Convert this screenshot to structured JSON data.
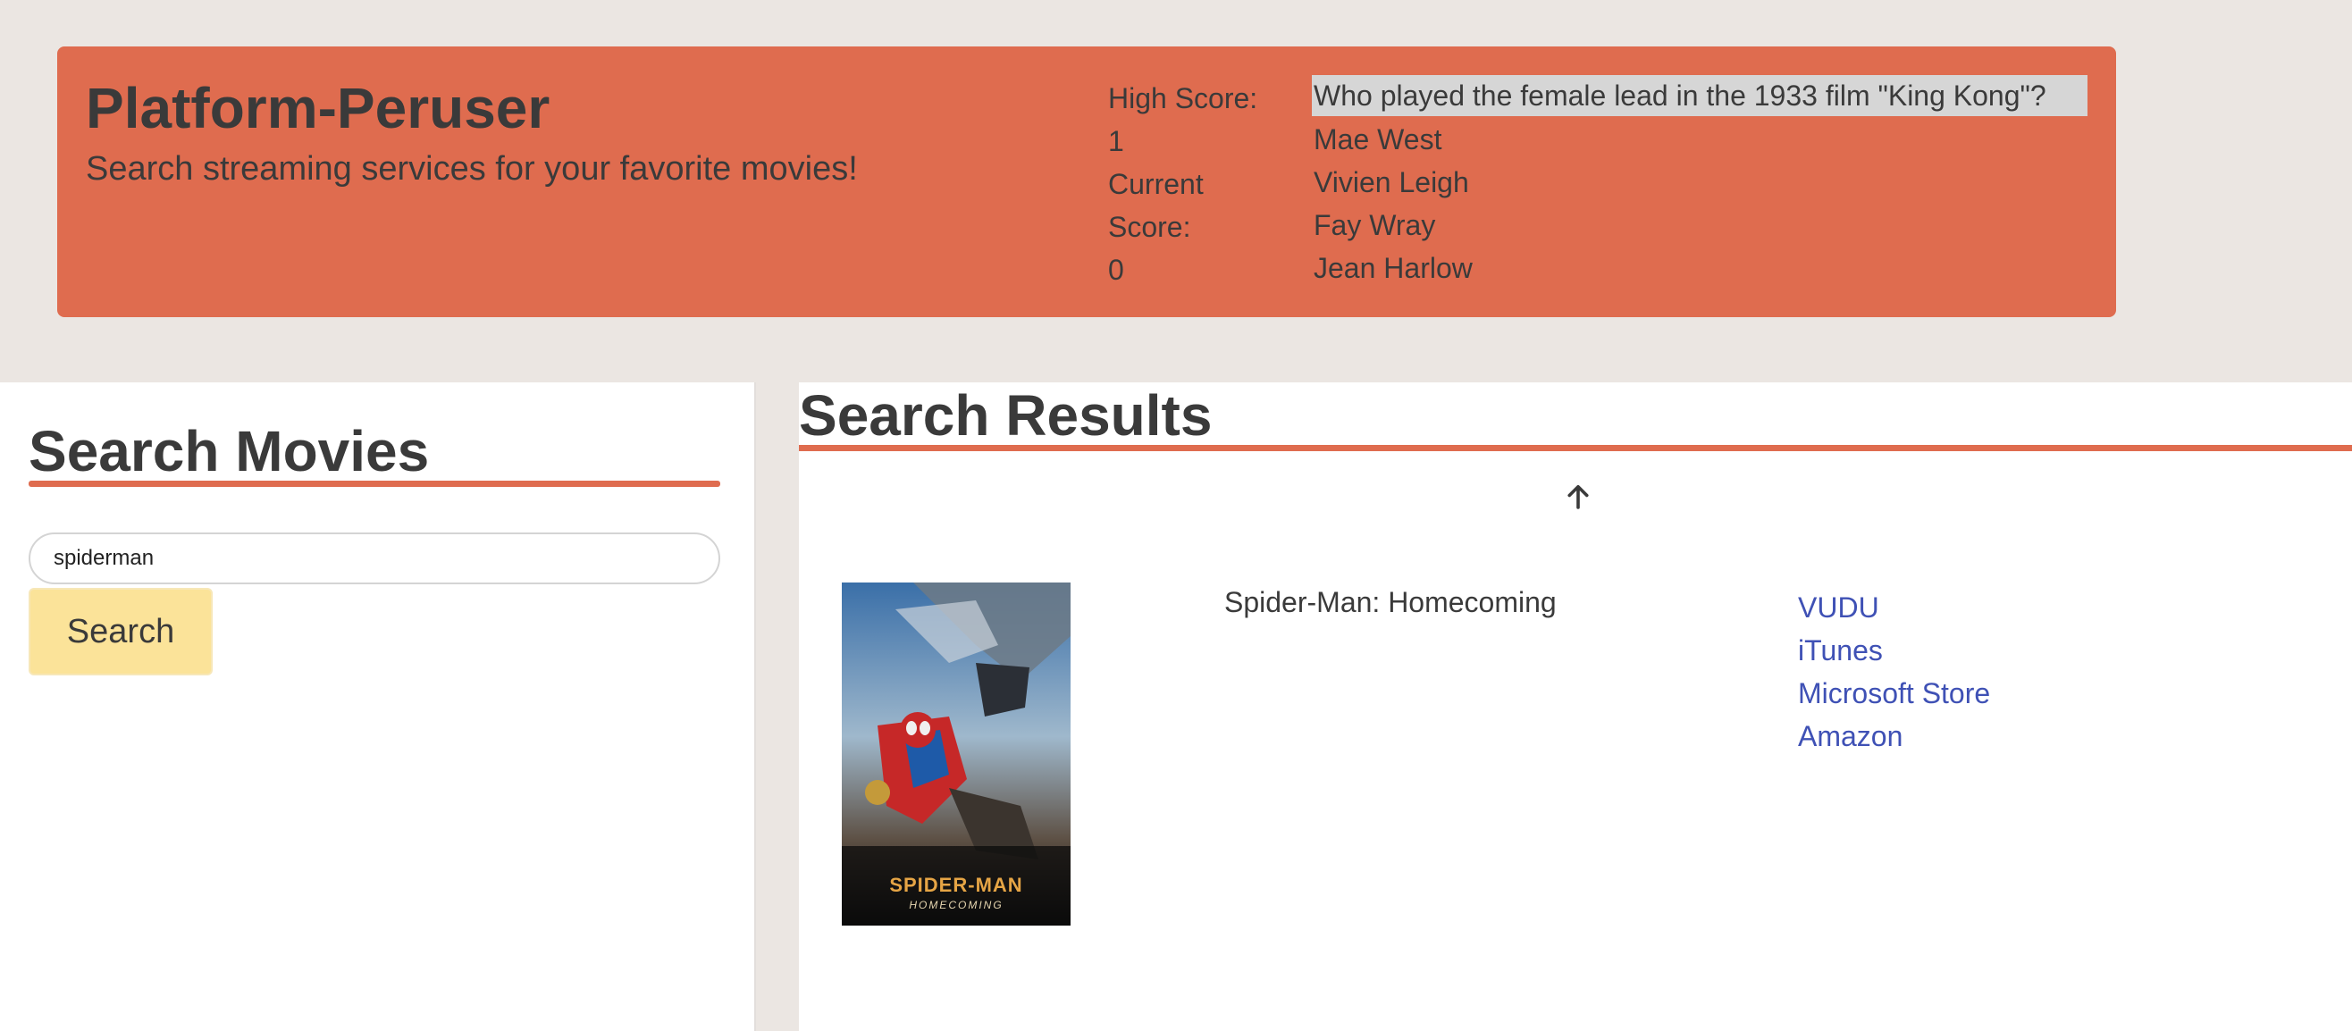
{
  "header": {
    "title": "Platform-Peruser",
    "subtitle": "Search streaming services for your favorite movies!"
  },
  "scores": {
    "high_label": "High Score:",
    "high_value": "1",
    "current_label_1": "Current",
    "current_label_2": "Score:",
    "current_value": "0"
  },
  "trivia": {
    "question": "Who played the female lead in the 1933 film \"King Kong\"?",
    "options": [
      "Mae West",
      "Vivien Leigh",
      "Fay Wray",
      "Jean Harlow"
    ]
  },
  "search": {
    "heading": "Search Movies",
    "input_value": "spiderman",
    "button_label": "Search"
  },
  "results": {
    "heading": "Search Results",
    "up_icon": "arrow-up-icon",
    "items": [
      {
        "title": "Spider-Man: Homecoming",
        "poster_text": "SPIDER-MAN",
        "poster_subtext": "HOMECOMING",
        "providers": [
          "VUDU",
          "iTunes",
          "Microsoft Store",
          "Amazon"
        ]
      }
    ]
  },
  "colors": {
    "header_bg": "#df6c4f",
    "page_bg": "#ebe6e2",
    "accent": "#df6c4f",
    "button_bg": "#fbe399",
    "link": "#3f51b5"
  }
}
